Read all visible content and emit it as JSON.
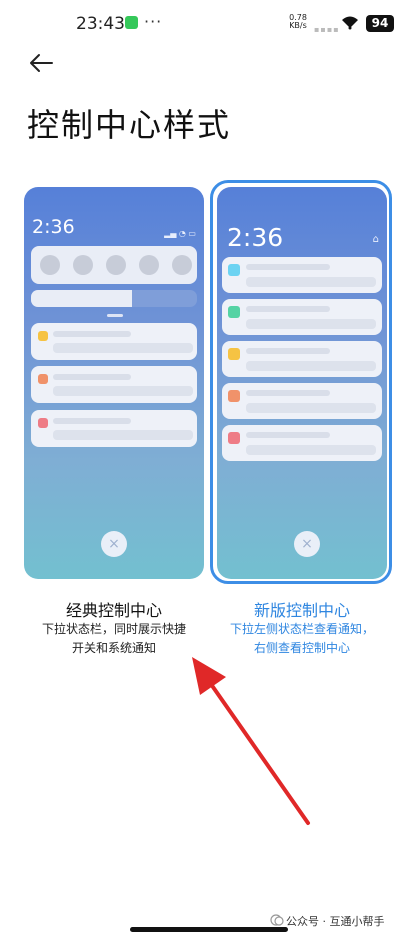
{
  "status_bar": {
    "time": "23:43",
    "dots": "···",
    "net_speed_value": "0.78",
    "net_speed_unit": "KB/s",
    "battery": "94"
  },
  "header": {
    "title": "控制中心样式"
  },
  "options": [
    {
      "title": "经典控制中心",
      "desc_line1": "下拉状态栏，同时展示快捷",
      "desc_line2": "开关和系统通知",
      "preview_time": "2:36",
      "selected": false
    },
    {
      "title": "新版控制中心",
      "desc_line1": "下拉左侧状态栏查看通知，",
      "desc_line2": "右侧查看控制中心",
      "preview_time": "2:36",
      "selected": true
    }
  ],
  "close_icon": "×",
  "watermark": "公众号 · 互通小帮手",
  "colors": {
    "accent": "#2f86e0",
    "dots": [
      "#f6c343",
      "#f0926a",
      "#ee7c86"
    ],
    "dots_new": [
      "#6cd3f2",
      "#55d3a4",
      "#f6c343",
      "#f0926a",
      "#ee7c86"
    ]
  }
}
